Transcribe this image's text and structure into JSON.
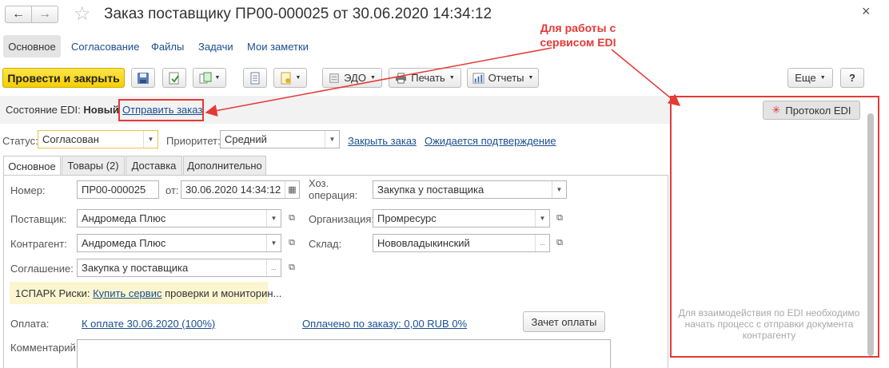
{
  "window": {
    "title": "Заказ поставщику ПР00-000025 от 30.06.2020 14:34:12",
    "close_icon": "×"
  },
  "nav_tabs": [
    {
      "label": "Основное"
    },
    {
      "label": "Согласование"
    },
    {
      "label": "Файлы"
    },
    {
      "label": "Задачи"
    },
    {
      "label": "Мои заметки"
    }
  ],
  "toolbar": {
    "post_close": "Провести и закрыть",
    "edo": "ЭДО",
    "print": "Печать",
    "reports": "Отчеты",
    "more": "Еще",
    "help": "?"
  },
  "annotation": {
    "line1": "Для работы с",
    "line2": "сервисом EDI",
    "color": "#e53935"
  },
  "edi": {
    "state_label": "Состояние EDI:",
    "state_value": "Новый",
    "send_link": "Отправить заказ",
    "protocol_button": "Протокол EDI",
    "hint_line1": "Для взаимодействия по EDI необходимо",
    "hint_line2": "начать процесс с отправки документа",
    "hint_line3": "контрагенту"
  },
  "status": {
    "label": "Статус:",
    "value": "Согласован",
    "priority_label": "Приоритет:",
    "priority_value": "Средний",
    "close_link": "Закрыть заказ",
    "confirm_link": "Ожидается подтверждение"
  },
  "doc_tabs": [
    {
      "label": "Основное"
    },
    {
      "label": "Товары (2)"
    },
    {
      "label": "Доставка"
    },
    {
      "label": "Дополнительно"
    }
  ],
  "form": {
    "number_label": "Номер:",
    "number_value": "ПР00-000025",
    "from_label": "от:",
    "date_value": "30.06.2020 14:34:12",
    "operation_label_1": "Хоз.",
    "operation_label_2": "операция:",
    "operation_value": "Закупка у поставщика",
    "supplier_label": "Поставщик:",
    "supplier_value": "Андромеда Плюс",
    "org_label": "Организация:",
    "org_value": "Промресурс",
    "counterparty_label": "Контрагент:",
    "counterparty_value": "Андромеда Плюс",
    "warehouse_label": "Склад:",
    "warehouse_value": "Нововладыкинский",
    "agreement_label": "Соглашение:",
    "agreement_value": "Закупка у поставщика",
    "spark_prefix": "1СПАРК Риски:",
    "spark_link": "Купить сервис",
    "spark_text": "проверки и мониторин...",
    "payment_label": "Оплата:",
    "payment_link": "К оплате 30.06.2020 (100%)",
    "paid_link": "Оплачено по заказу: 0,00 RUB  0%",
    "offset_button": "Зачет оплаты",
    "comment_label": "Комментарий:"
  }
}
